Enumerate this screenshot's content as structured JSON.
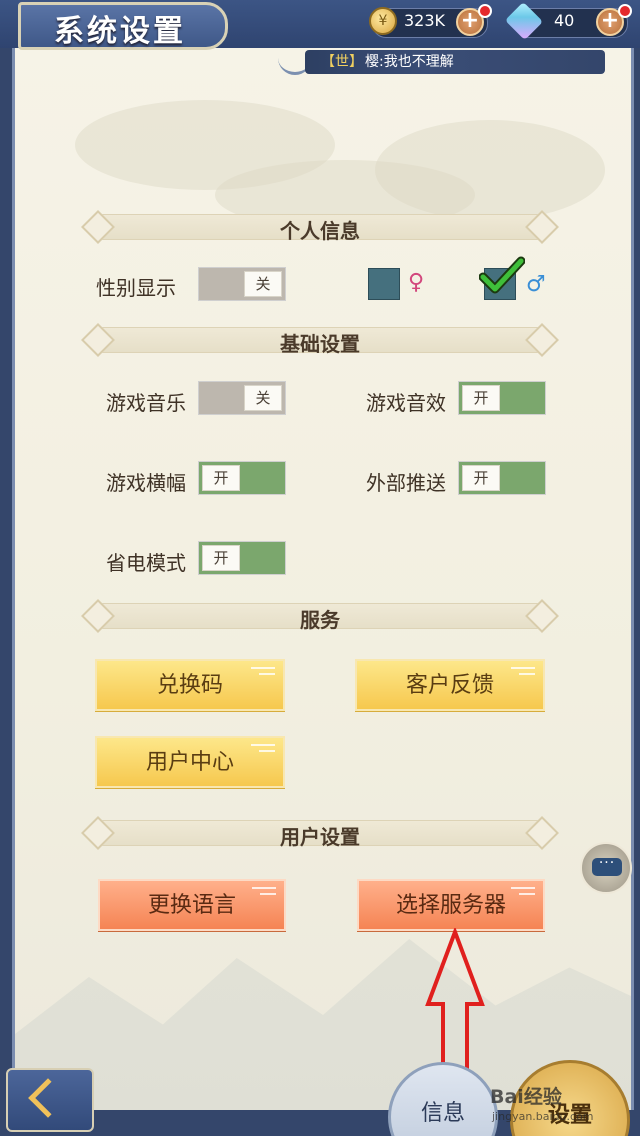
{
  "header": {
    "title": "系统设置",
    "gold": "323K",
    "gems": "40",
    "ticker_tag": "【世】",
    "ticker_text": "樱:我也不理解"
  },
  "sections": {
    "personal": "个人信息",
    "basic": "基础设置",
    "service": "服务",
    "user": "用户设置"
  },
  "personal": {
    "gender_label": "性别显示",
    "gender_toggle": "关",
    "female_symbol": "♀",
    "male_symbol": "♂",
    "male_selected": true
  },
  "basic": {
    "music_label": "游戏音乐",
    "music_toggle": "关",
    "sfx_label": "游戏音效",
    "sfx_toggle": "开",
    "banner_label": "游戏横幅",
    "banner_toggle": "开",
    "push_label": "外部推送",
    "push_toggle": "开",
    "power_label": "省电模式",
    "power_toggle": "开"
  },
  "service": {
    "redeem": "兑换码",
    "feedback": "客户反馈",
    "user_center": "用户中心"
  },
  "user": {
    "language": "更换语言",
    "server": "选择服务器"
  },
  "chat_icon": "···",
  "nav": {
    "info": "信息",
    "settings": "设置"
  },
  "watermark": {
    "brand": "Bai经验",
    "url": "jingyan.baidu.com"
  },
  "colors": {
    "toggle_on": "#7ba76d",
    "toggle_off": "#bdb7ae",
    "button_yellow": "#f6c84e",
    "button_orange": "#f58454",
    "arrow": "#e0201e"
  }
}
